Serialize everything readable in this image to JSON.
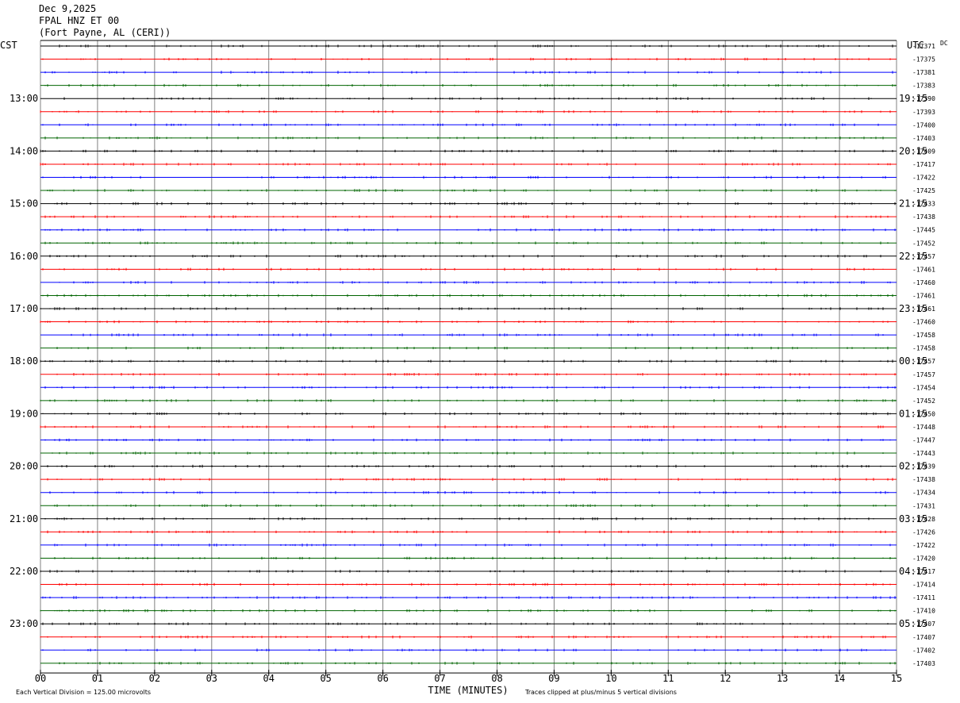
{
  "header": {
    "date": "Dec 9,2025",
    "station": "FPAL HNZ ET 00",
    "location": "(Fort Payne, AL (CERI))"
  },
  "colors": {
    "trace_cycle": [
      "#000000",
      "#ff0000",
      "#0000ff",
      "#006400"
    ],
    "grid": "#808080"
  },
  "chart_data": {
    "type": "line",
    "title": "Dec 9,2025 FPAL HNZ ET 00 (Fort Payne, AL (CERI))",
    "left_axis_label": "CST",
    "right_axis_label": "UTC",
    "dc_label": "DC",
    "xlabel": "TIME (MINUTES)",
    "x_ticks": [
      "00",
      "01",
      "02",
      "03",
      "04",
      "05",
      "06",
      "07",
      "08",
      "09",
      "10",
      "11",
      "12",
      "13",
      "14",
      "15"
    ],
    "xlim": [
      0,
      15
    ],
    "rows_per_hour": 4,
    "cst_labels": [
      "13:00",
      "14:00",
      "15:00",
      "16:00",
      "17:00",
      "18:00",
      "19:00",
      "20:00",
      "21:00",
      "22:00",
      "23:00"
    ],
    "utc_labels": [
      "19:15",
      "20:15",
      "21:15",
      "22:15",
      "23:15",
      "00:15",
      "01:15",
      "02:15",
      "03:15",
      "04:15",
      "05:15"
    ],
    "first_labeled_row": 4,
    "dc_offsets": [
      -17371,
      -17375,
      -17381,
      -17383,
      -17390,
      -17393,
      -17400,
      -17403,
      -17409,
      -17417,
      -17422,
      -17425,
      -17433,
      -17438,
      -17445,
      -17452,
      -17457,
      -17461,
      -17460,
      -17461,
      -17461,
      -17460,
      -17458,
      -17458,
      -17457,
      -17457,
      -17454,
      -17452,
      -17450,
      -17448,
      -17447,
      -17443,
      -17439,
      -17438,
      -17434,
      -17431,
      -17428,
      -17426,
      -17422,
      -17420,
      -17417,
      -17414,
      -17411,
      -17410,
      -17407,
      -17407,
      -17402,
      -17403
    ],
    "footer_left": "Each Vertical Division =  125.00 microvolts",
    "footer_right": "Traces clipped at plus/minus 5 vertical divisions",
    "grid": true
  }
}
